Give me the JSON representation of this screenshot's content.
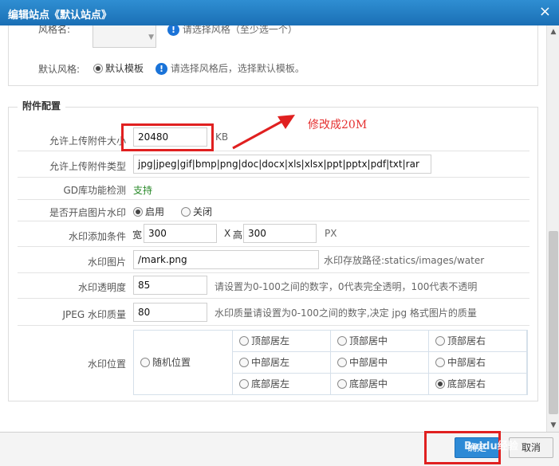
{
  "window": {
    "title": "编辑站点《默认站点》",
    "close_glyph": "×"
  },
  "style_section": {
    "style_label": "风格名:",
    "style_hint": "请选择风格（至少选一个）",
    "default_style_label": "默认风格:",
    "default_style_value": "默认模板",
    "default_style_hint": "请选择风格后，选择默认模板。"
  },
  "attachment": {
    "legend": "附件配置",
    "max_size_label": "允许上传附件大小",
    "max_size_value": "20480",
    "max_size_unit": "KB",
    "types_label": "允许上传附件类型",
    "types_value": "jpg|jpeg|gif|bmp|png|doc|docx|xls|xlsx|ppt|pptx|pdf|txt|rar",
    "gd_label": "GD库功能检测",
    "gd_value": "支持",
    "gd_color": "#2a8a2a",
    "watermark_enable_label": "是否开启图片水印",
    "watermark_on": "启用",
    "watermark_off": "关闭",
    "watermark_cond_label": "水印添加条件",
    "width_label": "宽",
    "width_value": "300",
    "x_sep": "X",
    "height_label": "高",
    "height_value": "300",
    "px_unit": "PX",
    "watermark_img_label": "水印图片",
    "watermark_img_value": "/mark.png",
    "watermark_img_hint": "水印存放路径:statics/images/water",
    "transparency_label": "水印透明度",
    "transparency_value": "85",
    "transparency_hint": "请设置为0-100之间的数字，0代表完全透明，100代表不透明",
    "jpeg_quality_label": "JPEG 水印质量",
    "jpeg_quality_value": "80",
    "jpeg_quality_hint": "水印质量请设置为0-100之间的数字,决定 jpg 格式图片的质量",
    "position_label": "水印位置",
    "random_position": "随机位置",
    "positions": [
      "顶部居左",
      "顶部居中",
      "顶部居右",
      "中部居左",
      "中部居中",
      "中部居右",
      "底部居左",
      "底部居中",
      "底部居右"
    ],
    "selected_position": "底部居右"
  },
  "annotation": {
    "text": "修改成20M",
    "color": "#e02020"
  },
  "footer": {
    "ok_label": "确定",
    "cancel_label": "取消",
    "watermark_text": "Baidu经验"
  },
  "colors": {
    "titlebar": "#1a6fb5",
    "primary_button": "#2d8ad6",
    "info_icon": "#1a73d8"
  }
}
